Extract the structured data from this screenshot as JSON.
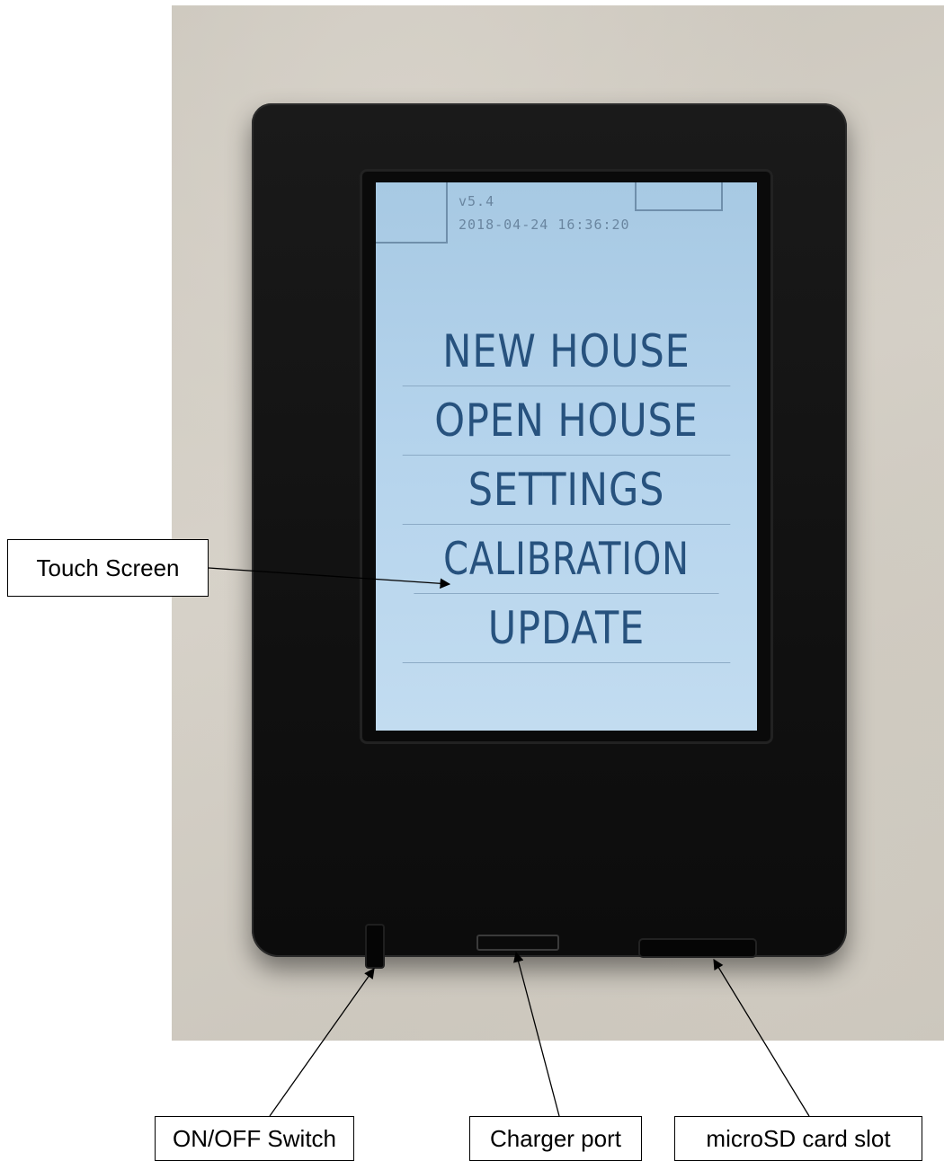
{
  "device_screen": {
    "version": "v5.4",
    "datetime": "2018-04-24 16:36:20",
    "menu": [
      {
        "label": "NEW HOUSE"
      },
      {
        "label": "OPEN HOUSE"
      },
      {
        "label": "SETTINGS"
      },
      {
        "label": "CALIBRATION"
      },
      {
        "label": "UPDATE"
      }
    ]
  },
  "callouts": {
    "touch_screen": "Touch Screen",
    "on_off_switch": "ON/OFF Switch",
    "charger_port": "Charger port",
    "microsd_slot": "microSD card slot"
  }
}
